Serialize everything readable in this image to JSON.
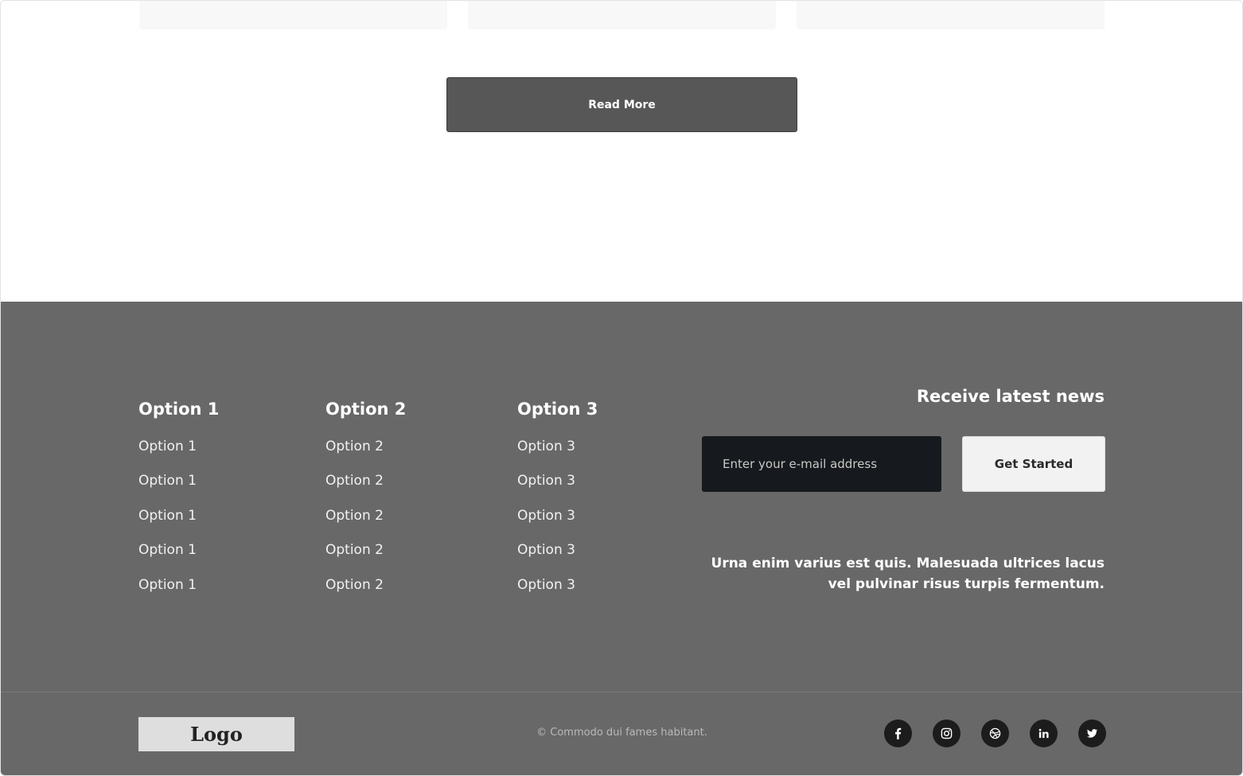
{
  "top": {
    "read_more_label": "Read More"
  },
  "footer": {
    "columns": [
      {
        "title": "Option 1",
        "items": [
          "Option 1",
          "Option 1",
          "Option 1",
          "Option 1",
          "Option 1"
        ]
      },
      {
        "title": "Option 2",
        "items": [
          "Option 2",
          "Option 2",
          "Option 2",
          "Option 2",
          "Option 2"
        ]
      },
      {
        "title": "Option 3",
        "items": [
          "Option 3",
          "Option 3",
          "Option 3",
          "Option 3",
          "Option 3"
        ]
      }
    ],
    "newsletter": {
      "title": "Receive latest news",
      "email_placeholder": "Enter your e-mail address",
      "submit_label": "Get Started",
      "text": "Urna enim varius est quis. Malesuada ultrices lacus vel pulvinar risus turpis fermentum."
    },
    "bottom": {
      "logo_text": "Logo",
      "copyright": "© Commodo dui fames habitant.",
      "socials": [
        "facebook-icon",
        "instagram-icon",
        "dribbble-icon",
        "linkedin-icon",
        "twitter-icon"
      ]
    }
  },
  "colors": {
    "footer_bg": "#686868",
    "button_dark": "#575757",
    "input_bg": "#16191d",
    "social_bg": "#1c1c1c"
  }
}
